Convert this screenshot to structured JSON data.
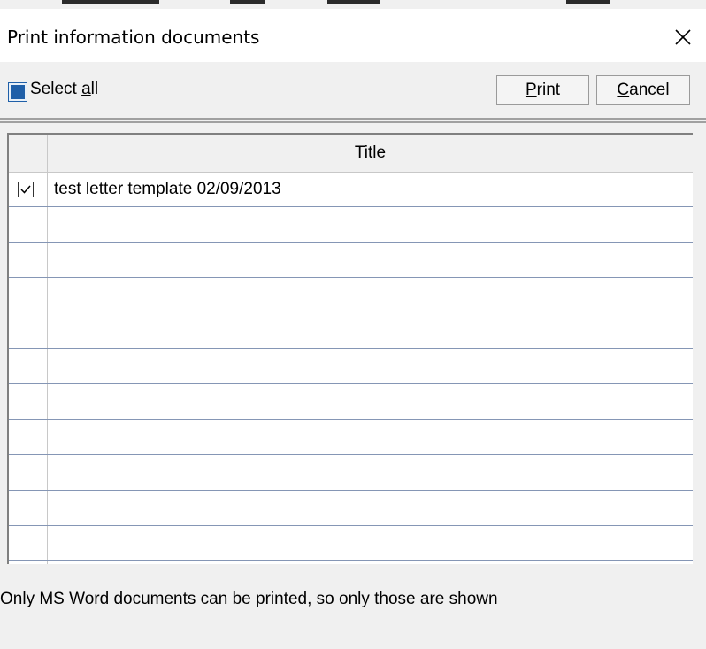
{
  "dialog": {
    "title": "Print information documents"
  },
  "toolbar": {
    "select_all_prefix": "Select ",
    "select_all_mnemonic": "a",
    "select_all_suffix": "ll",
    "select_all_checked": true,
    "print_mnemonic": "P",
    "print_rest": "rint",
    "cancel_mnemonic": "C",
    "cancel_rest": "ancel"
  },
  "table": {
    "column_title": "Title",
    "rows": [
      {
        "title": "test letter template 02/09/2013",
        "checked": true
      }
    ]
  },
  "footer": {
    "note": "Only MS Word documents can be printed, so only those are shown"
  },
  "colors": {
    "select_all_fill": "#1f5fa8",
    "row_line": "#8596b5"
  },
  "icons": {
    "close": "close-icon",
    "check": "checkmark-icon"
  }
}
